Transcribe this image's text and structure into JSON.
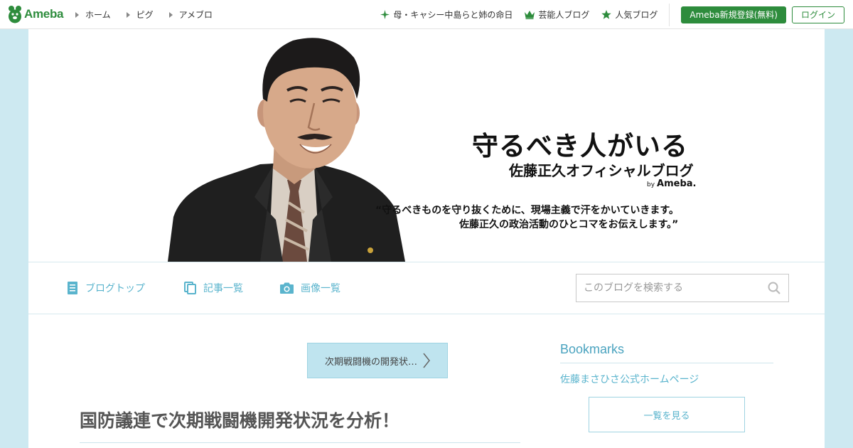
{
  "topbar": {
    "logo_text": "Ameba",
    "nav": [
      {
        "label": "ホーム"
      },
      {
        "label": "ピグ"
      },
      {
        "label": "アメブロ"
      }
    ],
    "right_links": [
      {
        "label": "母・キャシー中島らと姉の命日",
        "icon": "sparkle-icon"
      },
      {
        "label": "芸能人ブログ",
        "icon": "crown-icon"
      },
      {
        "label": "人気ブログ",
        "icon": "star-icon"
      }
    ],
    "register_label": "Ameba新規登録(無料)",
    "login_label": "ログイン",
    "accent_color": "#2d8c3c"
  },
  "banner": {
    "title": "守るべき人がいる",
    "subtitle": "佐藤正久オフィシャルブログ",
    "by": "by",
    "by_brand": "Ameba.",
    "quote_line1": "“守るべきものを守り抜くために、現場主義で汗をかいていきます。",
    "quote_line2": "佐藤正久の政治活動のひとコマをお伝えします。”"
  },
  "blognav": {
    "items": [
      {
        "label": "ブログトップ",
        "icon": "document-icon"
      },
      {
        "label": "記事一覧",
        "icon": "copy-icon"
      },
      {
        "label": "画像一覧",
        "icon": "camera-icon"
      }
    ],
    "search_placeholder": "このブログを検索する",
    "accent_color": "#5ab4cd"
  },
  "content": {
    "next_article_label": "次期戦闘機の開発状…",
    "article_title": "国防議連で次期戦闘機開発状況を分析！"
  },
  "sidebar": {
    "bookmarks_heading": "Bookmarks",
    "bookmark_link": "佐藤まさひさ公式ホームページ",
    "more_label": "一覧を見る"
  }
}
